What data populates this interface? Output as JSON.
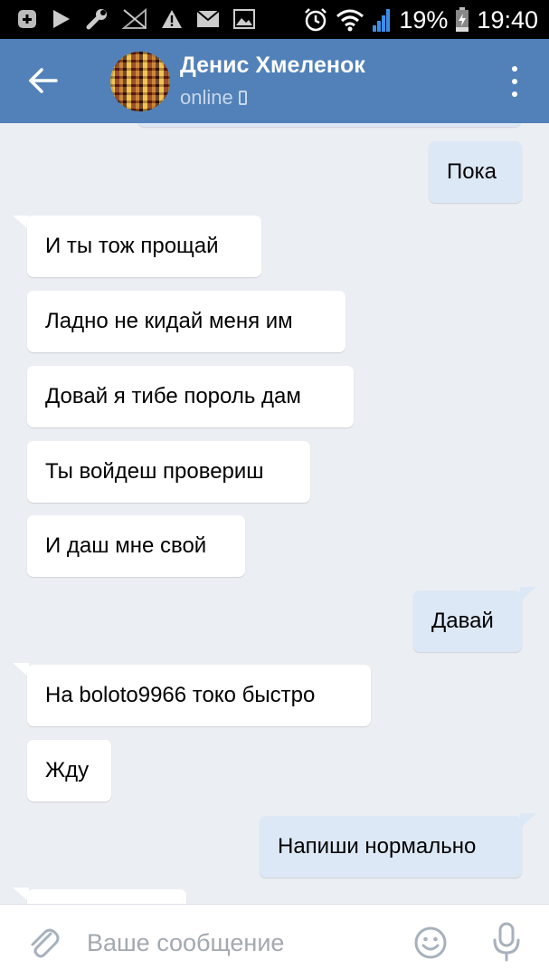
{
  "status_bar": {
    "battery": "19%",
    "time": "19:40",
    "left_icons": [
      "plus-icon",
      "play-icon",
      "wrench-icon",
      "no-signal-icon",
      "warning-icon",
      "mail-icon",
      "image-icon"
    ],
    "right_icons": [
      "alarm-icon",
      "wifi-icon",
      "signal-icon",
      "battery-icon"
    ]
  },
  "header": {
    "contact_name": "Денис Хмеленок",
    "status": "online",
    "colors": {
      "background": "#5181b8",
      "status_text": "#c7d7ea"
    }
  },
  "messages": [
    {
      "direction": "out",
      "text": "Пока"
    },
    {
      "direction": "in",
      "text": "И ты тож прощай"
    },
    {
      "direction": "in",
      "text": "Ладно не кидай меня им"
    },
    {
      "direction": "in",
      "text": "Довай я тибе пороль дам"
    },
    {
      "direction": "in",
      "text": "Ты войдеш провериш"
    },
    {
      "direction": "in",
      "text": "И даш мне свой"
    },
    {
      "direction": "out",
      "text": "Давай"
    },
    {
      "direction": "in",
      "text": "На boloto9966 токо быстро"
    },
    {
      "direction": "in",
      "text": "Жду"
    },
    {
      "direction": "out",
      "text": "Напиши нормально"
    }
  ],
  "input": {
    "placeholder": "Ваше сообщение",
    "value": ""
  },
  "colors": {
    "chat_background": "#ebeef2",
    "incoming_bubble": "#ffffff",
    "outgoing_bubble": "#dde8f6"
  }
}
